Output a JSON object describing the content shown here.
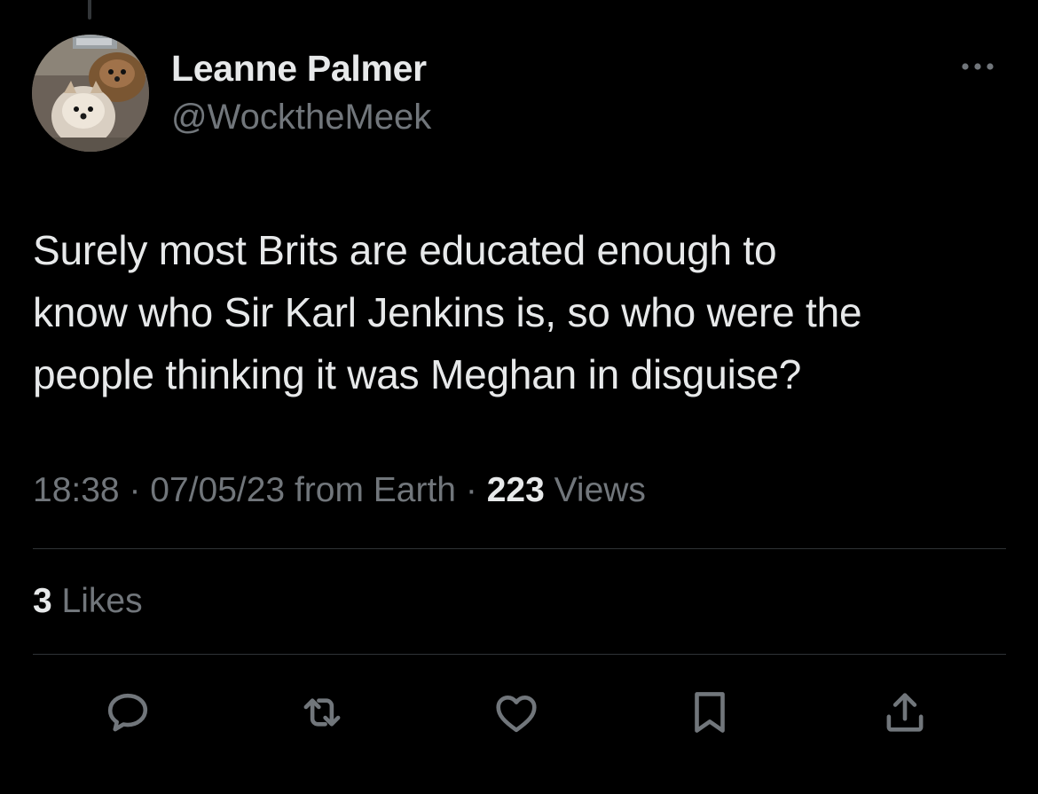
{
  "author": {
    "display_name": "Leanne Palmer",
    "handle": "@WocktheMeek",
    "avatar_icon": "pomeranian-dogs-photo"
  },
  "tweet": {
    "text_lines": [
      "Surely most Brits are educated enough to",
      "know who Sir Karl Jenkins is, so who were the",
      "people thinking it was Meghan in disguise?"
    ]
  },
  "meta": {
    "time": "18:38",
    "separator": "·",
    "date_source": "07/05/23 from Earth",
    "views_count": "223",
    "views_label": "Views"
  },
  "likes": {
    "count": "3",
    "label": "Likes"
  },
  "actions": [
    {
      "name": "reply",
      "icon": "reply-icon"
    },
    {
      "name": "retweet",
      "icon": "retweet-icon"
    },
    {
      "name": "like",
      "icon": "heart-icon"
    },
    {
      "name": "bookmark",
      "icon": "bookmark-icon"
    },
    {
      "name": "share",
      "icon": "share-icon"
    }
  ],
  "colors": {
    "background": "#000000",
    "primary_text": "#e7e9ea",
    "secondary_text": "#71767b",
    "divider": "#2f3336"
  }
}
